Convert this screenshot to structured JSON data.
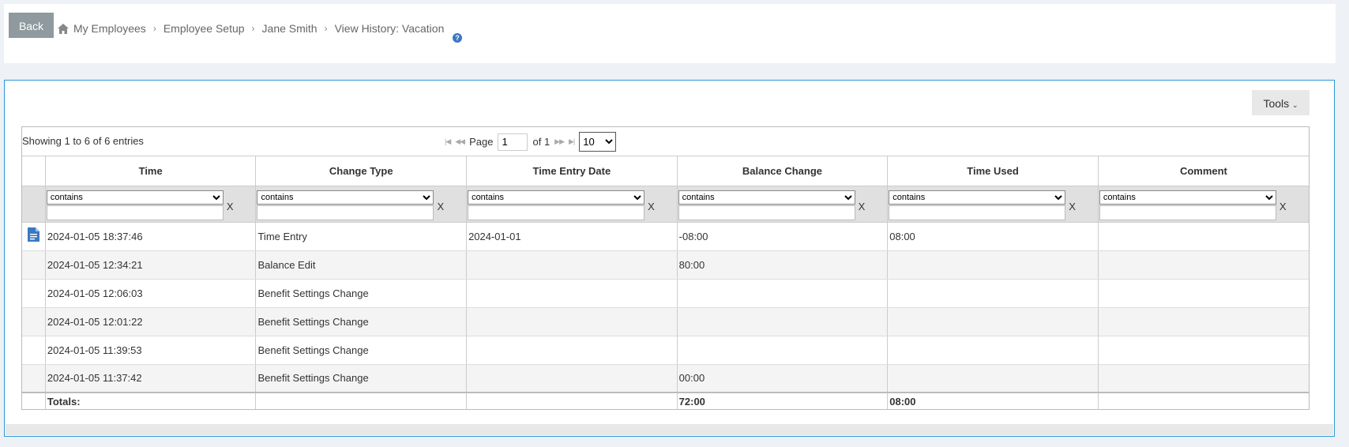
{
  "header": {
    "back_label": "Back",
    "breadcrumb": [
      "My Employees",
      "Employee Setup",
      "Jane Smith",
      "View History: Vacation"
    ],
    "help_glyph": "?"
  },
  "toolbar": {
    "tools_label": "Tools"
  },
  "grid": {
    "showing": "Showing 1 to 6 of 6 entries",
    "pager": {
      "page_label": "Page",
      "page_value": "1",
      "of_label": "of 1",
      "page_size": "10",
      "page_size_options": [
        "10"
      ]
    },
    "columns": [
      "Time",
      "Change Type",
      "Time Entry Date",
      "Balance Change",
      "Time Used",
      "Comment"
    ],
    "filter_option": "contains",
    "filter_clear": "X",
    "rows": [
      {
        "time": "2024-01-05 18:37:46",
        "change_type": "Time Entry",
        "entry_date": "2024-01-01",
        "balance_change": "-08:00",
        "time_used": "08:00",
        "comment": "",
        "icon": "document-icon"
      },
      {
        "time": "2024-01-05 12:34:21",
        "change_type": "Balance Edit",
        "entry_date": "",
        "balance_change": "80:00",
        "time_used": "",
        "comment": ""
      },
      {
        "time": "2024-01-05 12:06:03",
        "change_type": "Benefit Settings Change",
        "entry_date": "",
        "balance_change": "",
        "time_used": "",
        "comment": ""
      },
      {
        "time": "2024-01-05 12:01:22",
        "change_type": "Benefit Settings Change",
        "entry_date": "",
        "balance_change": "",
        "time_used": "",
        "comment": ""
      },
      {
        "time": "2024-01-05 11:39:53",
        "change_type": "Benefit Settings Change",
        "entry_date": "",
        "balance_change": "",
        "time_used": "",
        "comment": ""
      },
      {
        "time": "2024-01-05 11:37:42",
        "change_type": "Benefit Settings Change",
        "entry_date": "",
        "balance_change": "00:00",
        "time_used": "",
        "comment": ""
      }
    ],
    "totals": {
      "label": "Totals:",
      "balance_change": "72:00",
      "time_used": "08:00"
    }
  },
  "colors": {
    "accent": "#2a97d8",
    "back_button": "#8e9a9d",
    "icon_blue": "#3a78c2"
  }
}
